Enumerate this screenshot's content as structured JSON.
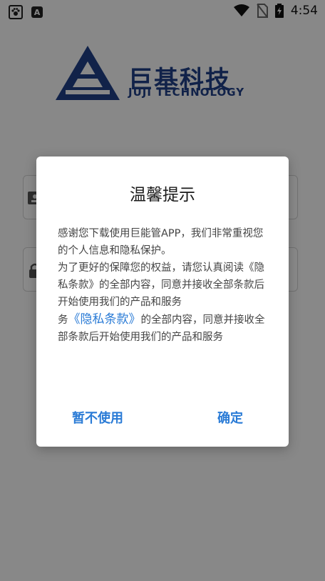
{
  "statusbar": {
    "time": "4:54",
    "left_icons": [
      "paw-icon",
      "a-icon"
    ],
    "right_icons": [
      "wifi-icon",
      "no-sim-icon",
      "battery-icon"
    ],
    "badge_letter": "A"
  },
  "logo": {
    "cn": "巨基科技",
    "en": "JUJI TECHNOLOGY",
    "color": "#1f3f86"
  },
  "dialog": {
    "title": "温馨提示",
    "body_para1": "感谢您下载使用巨能管APP，我们非常重视您的个人信息和隐私保护。",
    "body_para2": "为了更好的保障您的权益，请您认真阅读《隐私条款》的全部内容，同意并接收全部条款后开始使用我们的产品和服务",
    "body_prefix": "务",
    "privacy_link": "《隐私条款》",
    "body_para3": "的全部内容，同意并接收全部条款后开始使用我们的产品和服务",
    "cancel_label": "暂不使用",
    "ok_label": "确定",
    "accent": "#2a7bd6"
  }
}
